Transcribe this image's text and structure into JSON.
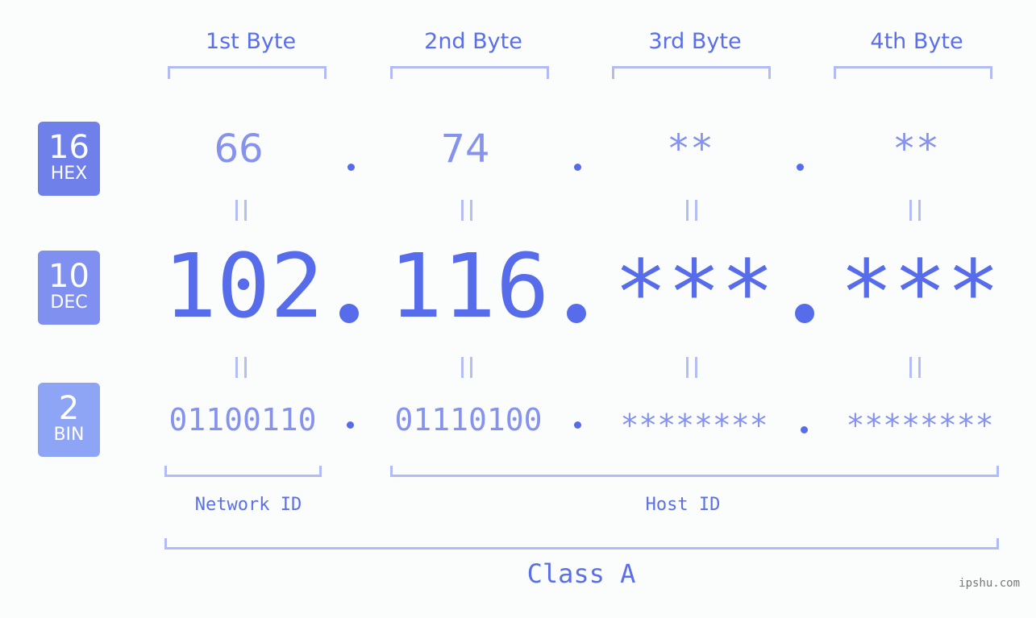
{
  "badges": [
    {
      "base": "16",
      "label": "HEX",
      "color": "#6f80ea"
    },
    {
      "base": "10",
      "label": "DEC",
      "color": "#8090f0"
    },
    {
      "base": "2",
      "label": "BIN",
      "color": "#8ea5f5"
    }
  ],
  "byte_headers": [
    "1st Byte",
    "2nd Byte",
    "3rd Byte",
    "4th Byte"
  ],
  "hex": [
    "66",
    "74",
    "**",
    "**"
  ],
  "dec": [
    "102",
    "116",
    "***",
    "***"
  ],
  "bin": [
    "01100110",
    "01110100",
    "********",
    "********"
  ],
  "separator": ".",
  "network_id_label": "Network ID",
  "host_id_label": "Host ID",
  "class_label": "Class A",
  "watermark": "ipshu.com",
  "colors": {
    "primary": "#576ceb",
    "light": "#8592ee",
    "bracket": "#b1bbf5"
  }
}
